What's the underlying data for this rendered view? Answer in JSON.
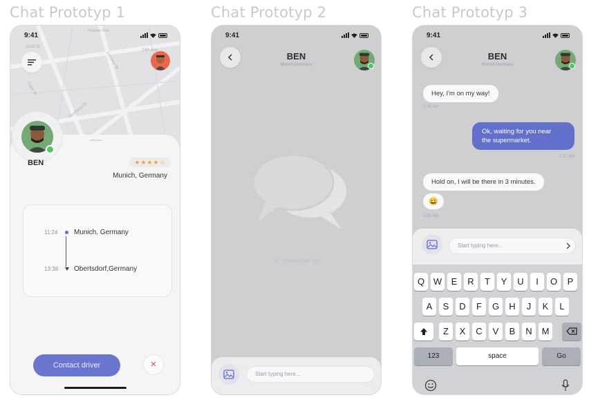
{
  "titles": [
    "Chat Prototyp 1",
    "Chat Prototyp 2",
    "Chat Prototyp 3"
  ],
  "status_time": "9:41",
  "proto1": {
    "map_labels": [
      "Hoover Ave",
      "22nd St",
      "Lindsey St",
      "Gaps St",
      "Pershing Gt",
      "24th Ave"
    ],
    "driver_name": "BEN",
    "rating_stars": "★★★★☆",
    "rating_value": 4,
    "location": "Munich, Germany",
    "route": [
      {
        "time": "11:24",
        "place": "Munich, Germany"
      },
      {
        "time": "13:38",
        "place": "Obertsdorf,Germany"
      }
    ],
    "contact_button": "Contact driver",
    "close_icon": "×"
  },
  "proto2": {
    "name": "BEN",
    "location": "Munich,Germany",
    "empty_text": "No messages yet",
    "input_placeholder": "Start typing here..."
  },
  "proto3": {
    "name": "BEN",
    "location": "Munich,Germany",
    "messages": [
      {
        "from": "them",
        "text": "Hey, I'm on my way!",
        "time": "2:36 AM"
      },
      {
        "from": "me",
        "line1": "Ok, waiting for you near",
        "line2": "the supermarket.",
        "time": "2:37 AM"
      },
      {
        "from": "them",
        "text": "Hold on, I will be there in 3 minutes."
      },
      {
        "from": "them",
        "emoji": "😀",
        "time": "2:38 AM"
      }
    ],
    "input_placeholder": "Start typing here...",
    "keyboard": {
      "row1": [
        "Q",
        "W",
        "E",
        "R",
        "T",
        "Y",
        "U",
        "I",
        "O",
        "P"
      ],
      "row2": [
        "A",
        "S",
        "D",
        "F",
        "G",
        "H",
        "J",
        "K",
        "L"
      ],
      "row3": [
        "Z",
        "X",
        "C",
        "V",
        "B",
        "N",
        "M"
      ],
      "numbers": "123",
      "space": "space",
      "go": "Go"
    }
  },
  "colors": {
    "accent": "#6370cb",
    "online": "#4cc86a",
    "star": "#f0a52a",
    "close": "#d54a5a"
  }
}
